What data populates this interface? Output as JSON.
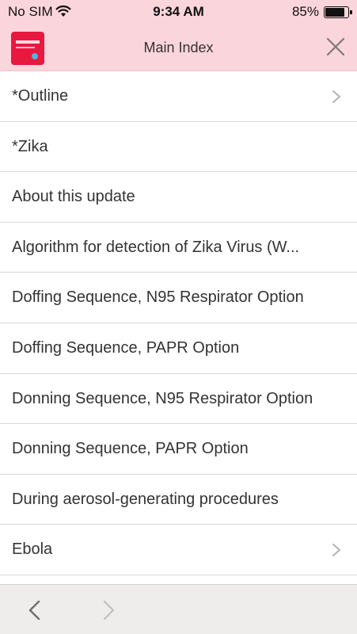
{
  "status_bar": {
    "carrier": "No SIM",
    "time": "9:34 AM",
    "battery_percent": "85%",
    "battery_level": 0.85
  },
  "nav": {
    "title": "Main Index",
    "close_icon": "close-icon",
    "brand_color": "#fbd5dc",
    "logo_color": "#e8183f"
  },
  "list": {
    "items": [
      {
        "label": "*Outline",
        "has_chevron": true
      },
      {
        "label": "*Zika",
        "has_chevron": false
      },
      {
        "label": "About this update",
        "has_chevron": false
      },
      {
        "label": "Algorithm for detection of Zika Virus (W...",
        "has_chevron": false
      },
      {
        "label": "Doffing Sequence, N95 Respirator Option",
        "has_chevron": false
      },
      {
        "label": "Doffing Sequence, PAPR Option",
        "has_chevron": false
      },
      {
        "label": "Donning Sequence, N95 Respirator Option",
        "has_chevron": false
      },
      {
        "label": "Donning Sequence, PAPR Option",
        "has_chevron": false
      },
      {
        "label": "During aerosol-generating procedures",
        "has_chevron": false
      },
      {
        "label": "Ebola",
        "has_chevron": true
      }
    ]
  },
  "toolbar": {
    "back_icon": "chevron-left-icon",
    "forward_icon": "chevron-right-icon",
    "forward_enabled": false
  }
}
